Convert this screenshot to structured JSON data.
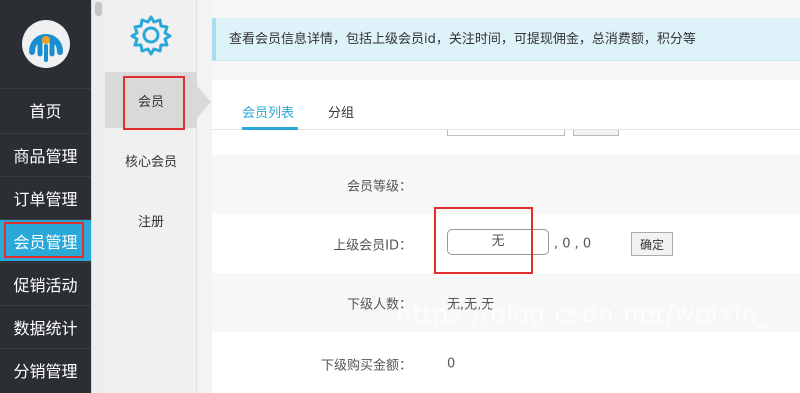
{
  "nav": {
    "items": [
      {
        "label": "首页",
        "active": false
      },
      {
        "label": "商品管理",
        "active": false
      },
      {
        "label": "订单管理",
        "active": false
      },
      {
        "label": "会员管理",
        "active": true
      },
      {
        "label": "促销活动",
        "active": false
      },
      {
        "label": "数据统计",
        "active": false
      },
      {
        "label": "分销管理",
        "active": false
      }
    ]
  },
  "sub": {
    "items": [
      {
        "label": "会员",
        "active": true
      },
      {
        "label": "核心会员",
        "active": false
      },
      {
        "label": "注册",
        "active": false
      }
    ]
  },
  "info_text": "查看会员信息详情，包括上级会员id，关注时间，可提现佣金，总消费额，积分等",
  "tabs": [
    {
      "label": "会员列表",
      "active": true
    },
    {
      "label": "分组",
      "active": false
    }
  ],
  "form": {
    "level_label": "会员等级：",
    "parent_label": "上级会员ID：",
    "parent_value": "无",
    "parent_extra": ", 0 , 0",
    "confirm_label": "确定",
    "children_label": "下级人数：",
    "children_value": "无,无,无",
    "children_amount_label": "下级购买金额：",
    "children_amount_value": "0"
  },
  "watermark": "https://blog.csdn.net/weixin_",
  "colors": {
    "accent": "#2aa9d8",
    "nav_bg": "#2b2e33",
    "highlight": "#e12f2f"
  }
}
